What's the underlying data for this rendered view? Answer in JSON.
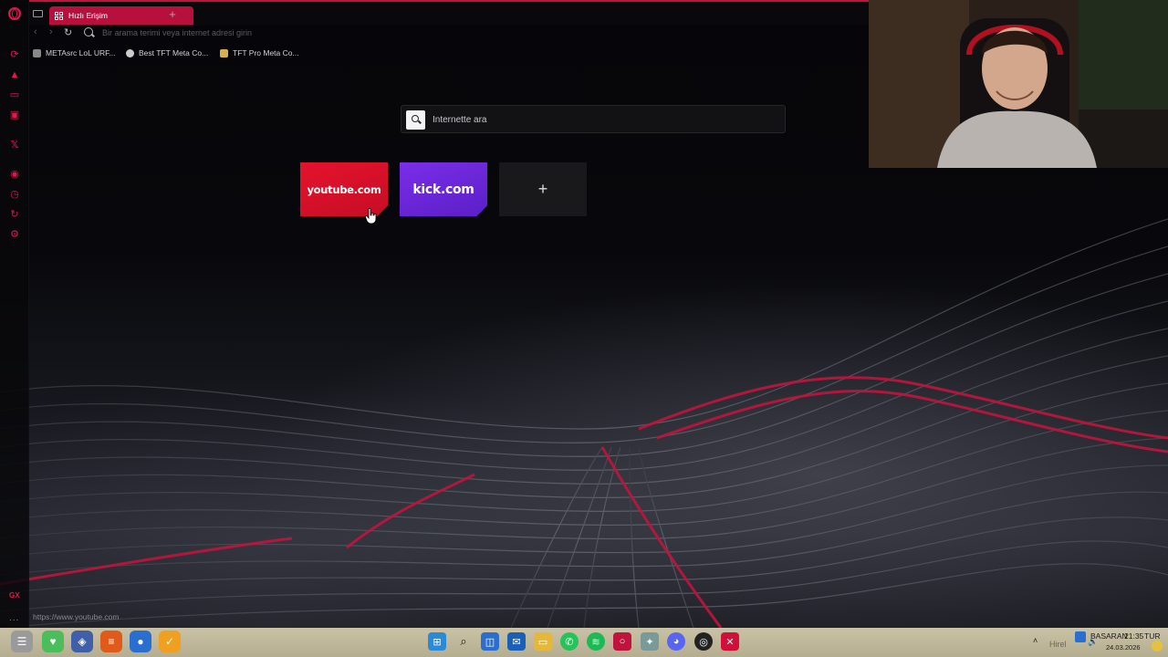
{
  "browser": {
    "tab": {
      "label": "Hızlı Erişim"
    },
    "new_tab_label": "+",
    "address_placeholder": "Bir arama terimi veya internet adresi girin",
    "bookmarks": [
      {
        "label": "METAsrc LoL URF...",
        "icon": "metasrc-icon"
      },
      {
        "label": "Best TFT Meta Co...",
        "icon": "tft-icon"
      },
      {
        "label": "TFT Pro Meta Co...",
        "icon": "tft-pro-icon"
      }
    ],
    "sidebar_icons": [
      "aria-icon",
      "shopping-icon",
      "messenger-icon",
      "news-icon",
      "x-twitter-icon",
      "player-icon",
      "history-icon",
      "gx-cleaner-icon",
      "settings-icon"
    ],
    "sidebar_gx_label": "GX",
    "sidebar_more": "..."
  },
  "speed_dial": {
    "search_placeholder": "İnternette ara",
    "tiles": [
      {
        "label": "youtube.com",
        "color": "#e4132c"
      },
      {
        "label": "kick.com",
        "color": "#6b27dc"
      }
    ],
    "add_label": "+"
  },
  "status_url": "https://www.youtube.com",
  "taskbar": {
    "tray_user": "BASARAN",
    "tray_time_partial": "21:35",
    "tray_date": "24.03.2026",
    "tray_lang": "TUR",
    "tray_overlay_text": "Hirel"
  },
  "colors": {
    "accent": "#e0174a",
    "tab_active": "#b8103d",
    "youtube_red": "#e4132c",
    "kick_purple": "#6b27dc"
  }
}
